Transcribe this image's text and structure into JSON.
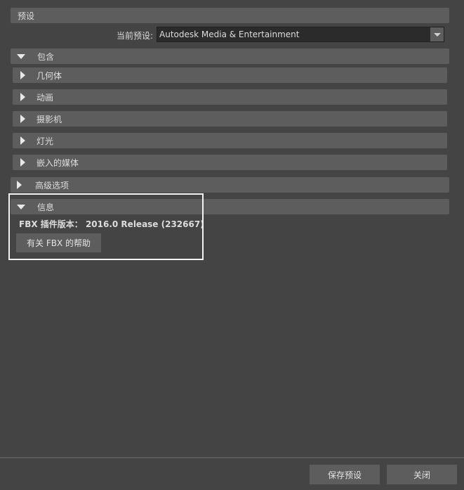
{
  "preset": {
    "header": "预设",
    "current_label": "当前预设:",
    "current_value": "Autodesk Media & Entertainment"
  },
  "include": {
    "header": "包含",
    "items": [
      {
        "label": "几何体"
      },
      {
        "label": "动画"
      },
      {
        "label": "摄影机"
      },
      {
        "label": "灯光"
      },
      {
        "label": "嵌入的媒体"
      }
    ]
  },
  "advanced": {
    "header": "高级选项"
  },
  "info": {
    "header": "信息",
    "plugin_version": "FBX 插件版本： 2016.0 Release (232667)",
    "help_button": "有关 FBX 的帮助"
  },
  "footer": {
    "save_preset": "保存预设",
    "close": "关闭"
  }
}
